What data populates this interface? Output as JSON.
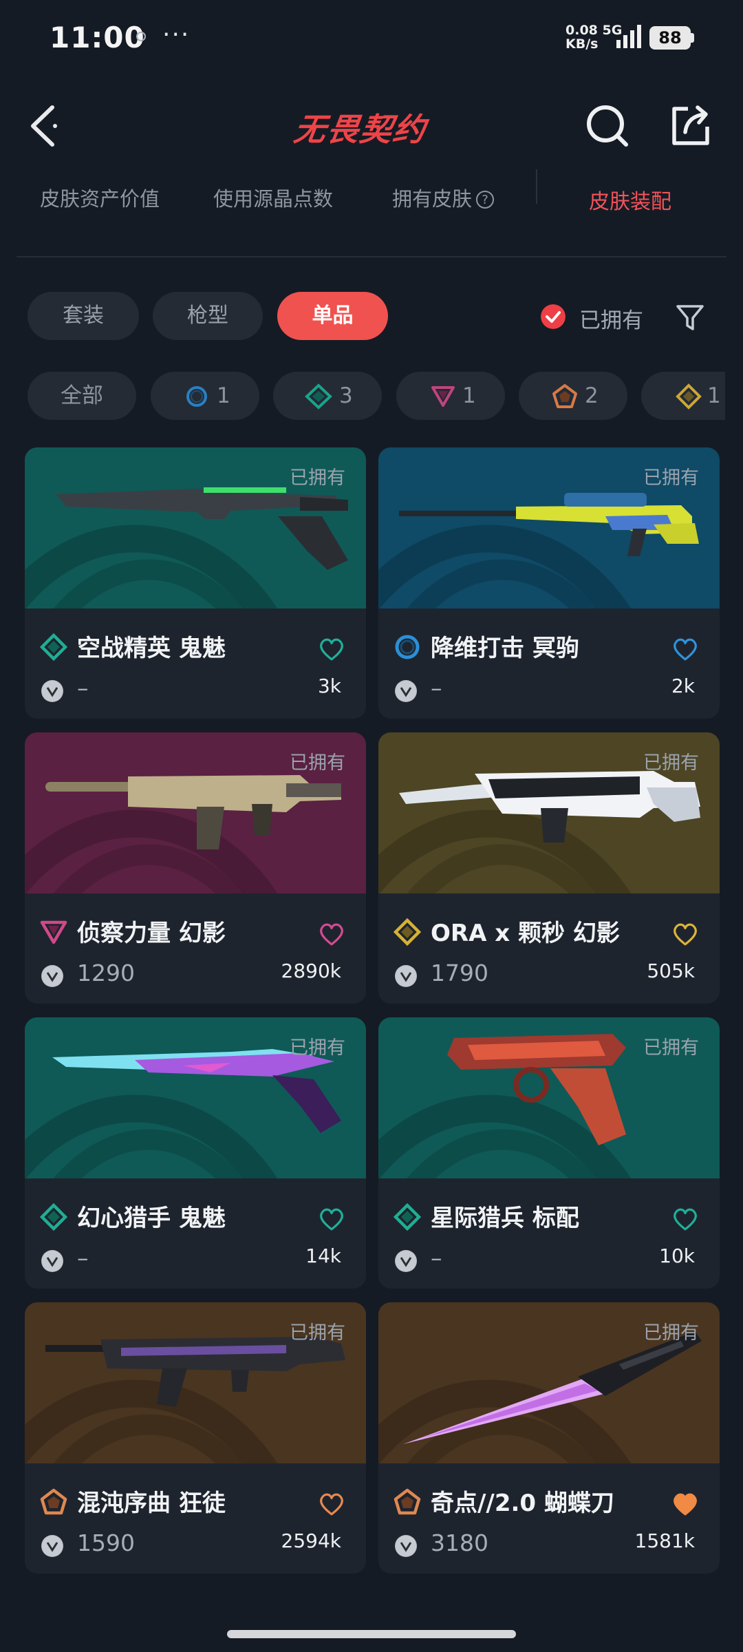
{
  "status": {
    "time": "11:00",
    "more": "···",
    "net_speed": "0.08",
    "net_unit": "KB/s",
    "net_type": "5G",
    "battery": "88"
  },
  "header": {
    "title": "无畏契约"
  },
  "stats_tabs": [
    {
      "label": "皮肤资产价值"
    },
    {
      "label": "使用源晶点数"
    },
    {
      "label": "拥有皮肤"
    }
  ],
  "stats_help": "?",
  "active_tab": "皮肤装配",
  "categories": [
    {
      "label": "套装"
    },
    {
      "label": "枪型"
    },
    {
      "label": "单品"
    }
  ],
  "owned_filter": {
    "label": "已拥有",
    "checked": true
  },
  "rarity_chips": [
    {
      "label": "全部"
    },
    {
      "icon": "select-tier-icon",
      "color": "#2a7fc1",
      "count": "1"
    },
    {
      "icon": "deluxe-tier-icon",
      "color": "#1aa38c",
      "count": "3"
    },
    {
      "icon": "premium-tier-icon",
      "color": "#c0447f",
      "count": "1"
    },
    {
      "icon": "exclusive-tier-icon",
      "color": "#d77a47",
      "count": "2"
    },
    {
      "icon": "ultra-tier-icon",
      "color": "#caa73a",
      "count": "1"
    }
  ],
  "skins": [
    {
      "owned": "已拥有",
      "name": "空战精英 鬼魅",
      "tier": "deluxe",
      "tier_color": "#1fae94",
      "price": "–",
      "likes": "3k",
      "heart_color": "#1fb09a",
      "heart_filled": false,
      "bg": "#0f5a56",
      "weapon": "pistol-ghost"
    },
    {
      "owned": "已拥有",
      "name": "降维打击 冥驹",
      "tier": "select",
      "tier_color": "#2c8fd6",
      "price": "–",
      "likes": "2k",
      "heart_color": "#2f93dc",
      "heart_filled": false,
      "bg": "#0f4a66",
      "weapon": "sniper-operator"
    },
    {
      "owned": "已拥有",
      "name": "侦察力量 幻影",
      "tier": "premium",
      "tier_color": "#cf4a8a",
      "price": "1290",
      "likes": "2890k",
      "heart_color": "#d24c90",
      "heart_filled": false,
      "bg": "#5a2142",
      "weapon": "rifle-phantom"
    },
    {
      "owned": "已拥有",
      "name": "ORA x 颗秒 幻影",
      "tier": "ultra",
      "tier_color": "#d6b234",
      "price": "1790",
      "likes": "505k",
      "heart_color": "#dcb43a",
      "heart_filled": false,
      "bg": "#4d4524",
      "weapon": "rifle-phantom-white"
    },
    {
      "owned": "已拥有",
      "name": "幻心猎手 鬼魅",
      "tier": "deluxe",
      "tier_color": "#1fae94",
      "price": "–",
      "likes": "14k",
      "heart_color": "#1fb09a",
      "heart_filled": false,
      "bg": "#0f5a56",
      "weapon": "pistol-ghost-purple"
    },
    {
      "owned": "已拥有",
      "name": "星际猎兵 标配",
      "tier": "deluxe",
      "tier_color": "#1fae94",
      "price": "–",
      "likes": "10k",
      "heart_color": "#1fb09a",
      "heart_filled": false,
      "bg": "#0f5a56",
      "weapon": "pistol-classic"
    },
    {
      "owned": "已拥有",
      "name": "混沌序曲 狂徒",
      "tier": "exclusive",
      "tier_color": "#e08850",
      "price": "1590",
      "likes": "2594k",
      "heart_color": "#e58a52",
      "heart_filled": false,
      "bg": "#4a3520",
      "weapon": "rifle-vandal"
    },
    {
      "owned": "已拥有",
      "name": "奇点//2.0 蝴蝶刀",
      "tier": "exclusive",
      "tier_color": "#e08850",
      "price": "3180",
      "likes": "1581k",
      "heart_color": "#f08a45",
      "heart_filled": true,
      "bg": "#4a3520",
      "weapon": "knife"
    }
  ]
}
